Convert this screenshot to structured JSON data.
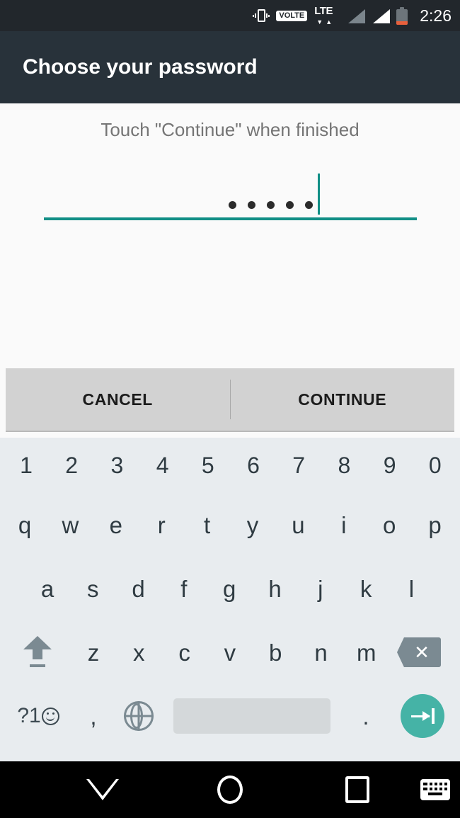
{
  "statusbar": {
    "time": "2:26",
    "volte_label": "VOLTE",
    "lte_label": "LTE",
    "data_down": "▼",
    "data_up": "▲",
    "icons": [
      "vibrate-icon",
      "volte-badge",
      "lte-icon",
      "signal-icon-1",
      "signal-icon-2",
      "battery-icon"
    ],
    "background": "#22272c"
  },
  "header": {
    "title": "Choose your password",
    "background": "#28323a",
    "text_color": "#ffffff"
  },
  "content": {
    "hint": "Touch \"Continue\" when finished",
    "hint_color": "#757575",
    "background": "#fafafa",
    "password_field": {
      "masked_char": "●",
      "char_count": 5,
      "caret_visible": true,
      "accent_color": "#128f86"
    }
  },
  "buttonbar": {
    "background": "#d2d2d2",
    "cancel_label": "CANCEL",
    "continue_label": "CONTINUE"
  },
  "keyboard": {
    "background": "#e8ecef",
    "key_color": "#2f3b42",
    "rows": {
      "numbers": [
        "1",
        "2",
        "3",
        "4",
        "5",
        "6",
        "7",
        "8",
        "9",
        "0"
      ],
      "top": [
        "q",
        "w",
        "e",
        "r",
        "t",
        "y",
        "u",
        "i",
        "o",
        "p"
      ],
      "home": [
        "a",
        "s",
        "d",
        "f",
        "g",
        "h",
        "j",
        "k",
        "l"
      ],
      "bottom": [
        "z",
        "x",
        "c",
        "v",
        "b",
        "n",
        "m"
      ]
    },
    "shift_key": "shift-key",
    "backspace_key": "backspace-key",
    "symbols_label": "?1",
    "comma_label": ",",
    "globe_key": "language-globe-key",
    "space_key": "space-key",
    "period_label": ".",
    "enter_key": "enter-next-key",
    "enter_color": "#45b3a6"
  },
  "navbar": {
    "background": "#000000",
    "items": [
      "back-icon",
      "home-icon",
      "recents-icon",
      "keyboard-icon"
    ]
  }
}
